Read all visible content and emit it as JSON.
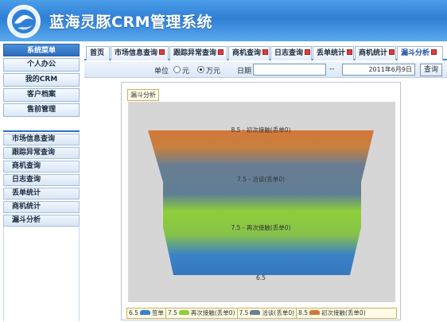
{
  "header": {
    "title": "蓝海灵豚CRM管理系统"
  },
  "sidebar": {
    "section_title": "系统菜单",
    "top_items": [
      {
        "label": "个人办公"
      },
      {
        "label": "我的CRM"
      },
      {
        "label": "客户档案"
      },
      {
        "label": "售前管理"
      }
    ],
    "sub_items": [
      {
        "label": "市场信息查询"
      },
      {
        "label": "跟踪异常查询"
      },
      {
        "label": "商机查询"
      },
      {
        "label": "日志查询"
      },
      {
        "label": "丢单统计"
      },
      {
        "label": "商机统计"
      },
      {
        "label": "漏斗分析"
      }
    ]
  },
  "tabs": [
    {
      "label": "首页",
      "closable": false
    },
    {
      "label": "市场信息查询",
      "closable": true
    },
    {
      "label": "跟踪异常查询",
      "closable": true
    },
    {
      "label": "商机查询",
      "closable": true
    },
    {
      "label": "日志查询",
      "closable": true
    },
    {
      "label": "丢单统计",
      "closable": true
    },
    {
      "label": "商机统计",
      "closable": true
    },
    {
      "label": "漏斗分析",
      "closable": true,
      "active": true
    }
  ],
  "toolbar": {
    "unit_label": "单位",
    "unit_options": [
      {
        "label": "元",
        "selected": false
      },
      {
        "label": "万元",
        "selected": true
      }
    ],
    "date_label": "日期",
    "date_from": "",
    "date_separator": "--",
    "date_to": "2011年6月9日",
    "query_label": "查询"
  },
  "panel": {
    "tag": "漏斗分析"
  },
  "chart_data": {
    "type": "funnel",
    "stages": [
      {
        "label": "8.5 - 初次接触(丢单0)",
        "value": 8.5,
        "color": "#d4783a"
      },
      {
        "label": "7.5 - 洽谈(丢单0)",
        "value": 7.5,
        "color": "#6a7d92"
      },
      {
        "label": "7.5 - 再次接触(丢单0)",
        "value": 7.5,
        "color": "#8ecf3a"
      },
      {
        "label": "6.5",
        "value": 6.5,
        "color": "#3a82c8"
      }
    ],
    "legend": [
      {
        "value": "6.5",
        "name": "签单",
        "color": "#3a82c8"
      },
      {
        "value": "7.5",
        "name": "再次接触(丢单0)",
        "color": "#8ecf3a"
      },
      {
        "value": "7.5",
        "name": "洽谈(丢单0)",
        "color": "#6a7d92"
      },
      {
        "value": "8.5",
        "name": "初次接触(丢单0)",
        "color": "#d4783a"
      }
    ]
  }
}
